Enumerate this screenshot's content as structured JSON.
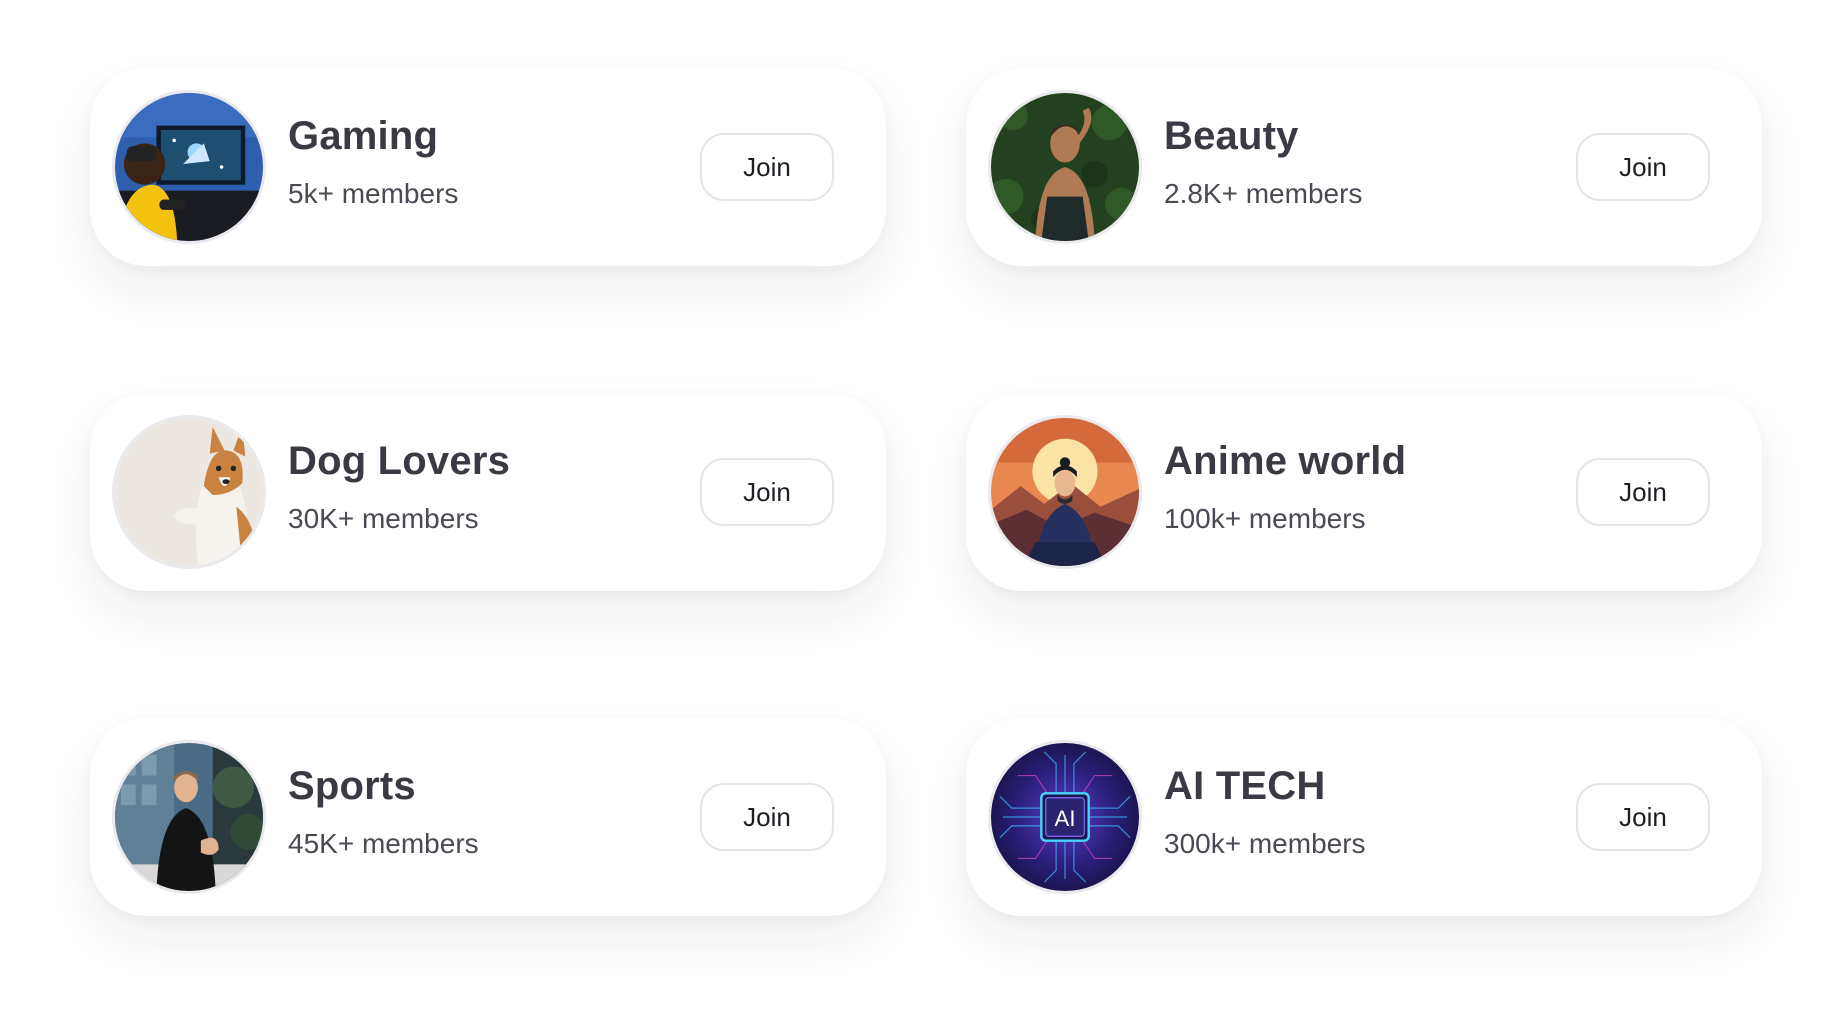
{
  "communities": [
    {
      "title": "Gaming",
      "members": "5k+ members",
      "join_label": "Join",
      "avatar_icon": "gaming-photo-icon"
    },
    {
      "title": "Beauty",
      "members": "2.8K+ members",
      "join_label": "Join",
      "avatar_icon": "beauty-photo-icon"
    },
    {
      "title": "Dog Lovers",
      "members": "30K+ members",
      "join_label": "Join",
      "avatar_icon": "dog-photo-icon"
    },
    {
      "title": "Anime world",
      "members": "100k+ members",
      "join_label": "Join",
      "avatar_icon": "anime-photo-icon"
    },
    {
      "title": "Sports",
      "members": "45K+ members",
      "join_label": "Join",
      "avatar_icon": "sports-photo-icon"
    },
    {
      "title": "AI TECH",
      "members": "300k+ members",
      "join_label": "Join",
      "avatar_icon": "ai-chip-icon",
      "avatar_text": "AI"
    }
  ]
}
